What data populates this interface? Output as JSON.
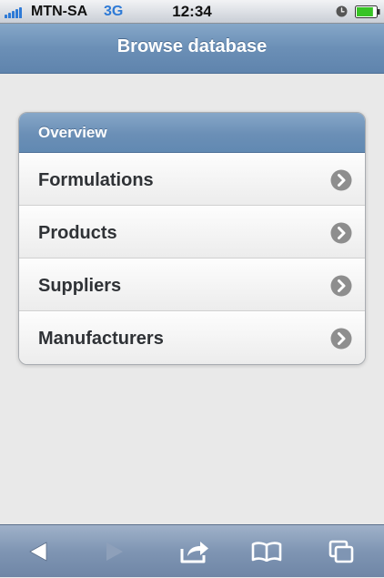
{
  "status_bar": {
    "carrier": "MTN-SA",
    "network": "3G",
    "time": "12:34",
    "signal_bars": 5,
    "battery_level": 0.85,
    "icons": [
      "signal-icon",
      "alarm-icon",
      "battery-icon"
    ]
  },
  "header": {
    "title": "Browse database"
  },
  "list": {
    "header": "Overview",
    "items": [
      {
        "label": "Formulations",
        "icon": "chevron-right-circle-icon"
      },
      {
        "label": "Products",
        "icon": "chevron-right-circle-icon"
      },
      {
        "label": "Suppliers",
        "icon": "chevron-right-circle-icon"
      },
      {
        "label": "Manufacturers",
        "icon": "chevron-right-circle-icon"
      }
    ]
  },
  "toolbar": {
    "buttons": [
      {
        "name": "back",
        "icon": "back-arrow-icon",
        "enabled": true
      },
      {
        "name": "forward",
        "icon": "forward-arrow-icon",
        "enabled": false
      },
      {
        "name": "share",
        "icon": "share-icon",
        "enabled": true
      },
      {
        "name": "bookmarks",
        "icon": "bookmarks-icon",
        "enabled": true
      },
      {
        "name": "tabs",
        "icon": "tabs-icon",
        "enabled": true
      }
    ]
  },
  "colors": {
    "accent_blue": "#6b8fb6",
    "network_blue": "#2e7ad6",
    "battery_green": "#37c425",
    "chevron_gray": "#8e8e8e",
    "item_text": "#2f3236"
  }
}
